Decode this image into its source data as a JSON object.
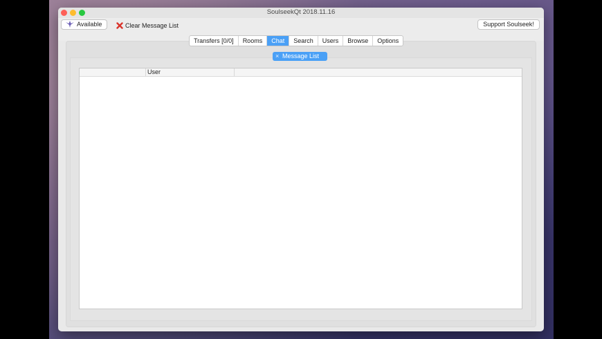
{
  "window": {
    "title": "SoulseekQt 2018.11.16"
  },
  "toolbar": {
    "status_label": "Available",
    "clear_label": "Clear Message List",
    "support_label": "Support Soulseek!"
  },
  "tabs": [
    {
      "label": "Transfers [0/0]",
      "active": false
    },
    {
      "label": "Rooms",
      "active": false
    },
    {
      "label": "Chat",
      "active": true
    },
    {
      "label": "Search",
      "active": false
    },
    {
      "label": "Users",
      "active": false
    },
    {
      "label": "Browse",
      "active": false
    },
    {
      "label": "Options",
      "active": false
    }
  ],
  "chat": {
    "subtab_label": "Message List",
    "subtab_close": "×"
  },
  "table": {
    "columns": [
      "",
      "User",
      ""
    ]
  },
  "colors": {
    "accent": "#4aa0f6",
    "close_light": "#fe5f57",
    "minimize_light": "#febc2e",
    "maximize_light": "#28c840"
  },
  "icons": {
    "status": "bird-icon",
    "clear": "red-x-icon",
    "subtab_close": "close-icon"
  }
}
